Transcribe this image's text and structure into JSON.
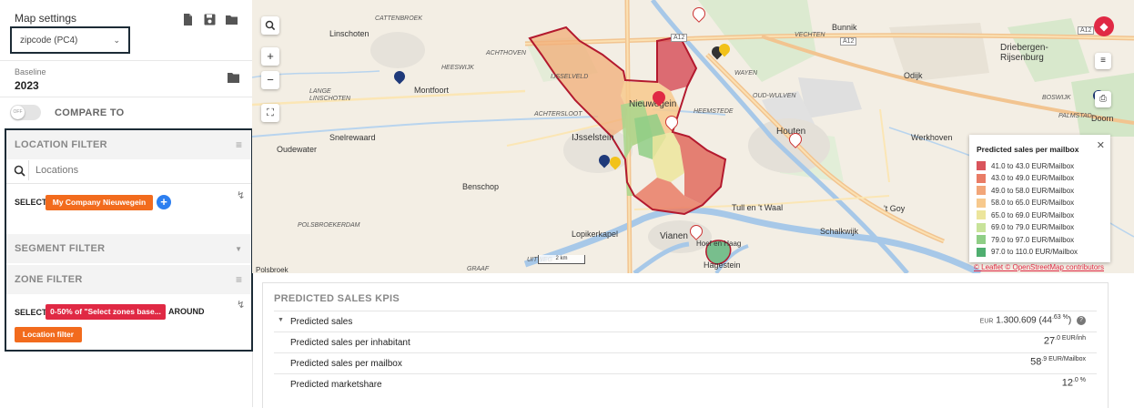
{
  "sidebar": {
    "title": "Map settings",
    "level_select": "zipcode (PC4)",
    "baseline_label": "Baseline",
    "baseline_value": "2023",
    "toggle_label": "OFF",
    "compare_label": "COMPARE TO",
    "location_filter": {
      "title": "LOCATION FILTER",
      "search_placeholder": "Locations",
      "select_label": "SELECT",
      "chip": "My Company Nieuwegein"
    },
    "segment_filter": {
      "title": "SEGMENT FILTER"
    },
    "zone_filter": {
      "title": "ZONE FILTER",
      "select_label": "SELECT",
      "chip": "0-50% of \"Select zones base...",
      "around_label": "AROUND",
      "location_chip": "Location filter"
    }
  },
  "map": {
    "places": {
      "linschoten": "Linschoten",
      "montfoort": "Montfoort",
      "oudewater": "Oudewater",
      "snelrewaard": "Snelrewaard",
      "ijsselstein": "IJsselstein",
      "benschop": "Benschop",
      "lopikerkapel": "Lopikerkapel",
      "vianen": "Vianen",
      "hagestein": "Hagestein",
      "houten": "Houten",
      "werkhoven": "Werkhoven",
      "bunnik": "Bunnik",
      "odijk": "Odijk",
      "driebergen": "Driebergen-Rijsenburg",
      "doorn": "Doorn",
      "schalkwijk": "Schalkwijk",
      "tull": "Tull en 't Waal",
      "tgoy": "'t Goy",
      "nieuwegein": "Nieuwegein",
      "hoef": "Hoef en Haag",
      "polsbroek": "Polsbroek"
    },
    "roads": {
      "cattenbroek": "CATTENBROEK",
      "heeswijk": "HEESWIJK",
      "achthoven": "ACHTHOVEN",
      "lange_linschoten": "LANGE LINSCHOTEN",
      "achtersloot": "ACHTERSLOOT",
      "wayen": "WAYEN",
      "oud_wulven": "OUD-WULVEN",
      "heemstede": "HEEMSTEDE",
      "vechten": "VECHTEN",
      "boswijk": "BOSWIJK",
      "palmstad": "PALMSTAD",
      "polsbroekerdam": "POLSBROEKERDAM",
      "graaf": "GRAAF",
      "uitweg": "UITWEG",
      "a12_1": "A12",
      "a12_2": "A12",
      "a12_3": "A12",
      "vreeswijk": "IJSSELVELD"
    },
    "scale": "2 km",
    "attribution": "© Leaflet © OpenStreetMap contributors",
    "legend": {
      "title": "Predicted sales per mailbox",
      "items": [
        {
          "label": "41.0 to 43.0 EUR/Mailbox",
          "color": "#d9545c"
        },
        {
          "label": "43.0 to 49.0 EUR/Mailbox",
          "color": "#e97c66"
        },
        {
          "label": "49.0 to 58.0 EUR/Mailbox",
          "color": "#f2a679"
        },
        {
          "label": "58.0 to 65.0 EUR/Mailbox",
          "color": "#f7c98d"
        },
        {
          "label": "65.0 to 69.0 EUR/Mailbox",
          "color": "#ece59c"
        },
        {
          "label": "69.0 to 79.0 EUR/Mailbox",
          "color": "#c8e39a"
        },
        {
          "label": "79.0 to 97.0 EUR/Mailbox",
          "color": "#8fce86"
        },
        {
          "label": "97.0 to 110.0 EUR/Mailbox",
          "color": "#4fae70"
        }
      ]
    }
  },
  "kpi": {
    "title": "PREDICTED SALES KPIS",
    "rows": [
      {
        "label": "Predicted sales",
        "currency": "EUR",
        "value": "1.300.609",
        "pct_open": " (44",
        "pct_dec": ".63 %",
        "pct_close": ")"
      },
      {
        "label": "Predicted sales per inhabitant",
        "value": "27",
        "dec": ".0 EUR/inh"
      },
      {
        "label": "Predicted sales per mailbox",
        "value": "58",
        "dec": ".9 EUR/Mailbox"
      },
      {
        "label": "Predicted marketshare",
        "value": "12",
        "dec": ".0 %"
      }
    ]
  },
  "colors": {
    "accent_orange": "#f26b1d",
    "accent_red": "#e02944",
    "plus_blue": "#2d7ff0",
    "outline_dark": "#1c2b36"
  }
}
